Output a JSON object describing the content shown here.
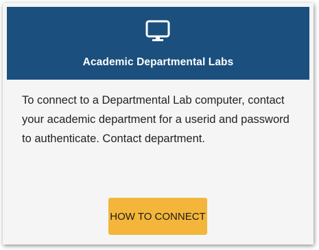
{
  "card": {
    "header": {
      "icon": "monitor-icon",
      "title": "Academic Departmental Labs"
    },
    "body_text": "To connect to a Departmental Lab computer, contact your academic department for a userid and password to authenticate. Contact department.",
    "button_label": "HOW TO CONNECT"
  },
  "colors": {
    "header_bg": "#1b4f7e",
    "card_bg": "#f5f5f5",
    "button_bg": "#f3b63a"
  }
}
